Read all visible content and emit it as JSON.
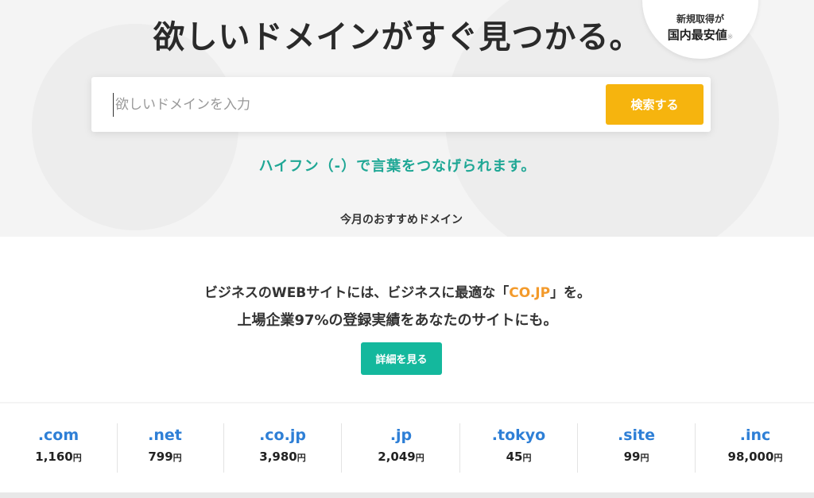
{
  "hero": {
    "title": "欲しいドメインがすぐ見つかる。",
    "badge_line1": "新規取得が",
    "badge_line2": "国内最安値",
    "badge_note": "※"
  },
  "search": {
    "placeholder": "欲しいドメインを入力",
    "button_label": "検索する",
    "hint": "ハイフン（-）で言葉をつなげられます。"
  },
  "recommend_heading": "今月のおすすめドメイン",
  "promo": {
    "line1_before": "ビジネスのWEBサイトには、ビジネスに最適な「",
    "line1_accent": "CO.JP",
    "line1_after": "」を。",
    "line2": "上場企業97%の登録実績をあなたのサイトにも。",
    "button_label": "詳細を見る",
    "accent_color": "#f39a2b"
  },
  "yen_label": "円",
  "tlds": [
    {
      "name": ".com",
      "price": "1,160"
    },
    {
      "name": ".net",
      "price": "799"
    },
    {
      "name": ".co.jp",
      "price": "3,980"
    },
    {
      "name": ".jp",
      "price": "2,049"
    },
    {
      "name": ".tokyo",
      "price": "45"
    },
    {
      "name": ".site",
      "price": "99"
    },
    {
      "name": ".inc",
      "price": "98,000"
    }
  ],
  "colors": {
    "search_button": "#f6b40e",
    "hint_text": "#1fa795",
    "detail_button": "#14b89d",
    "tld_link": "#2e7fd6"
  }
}
